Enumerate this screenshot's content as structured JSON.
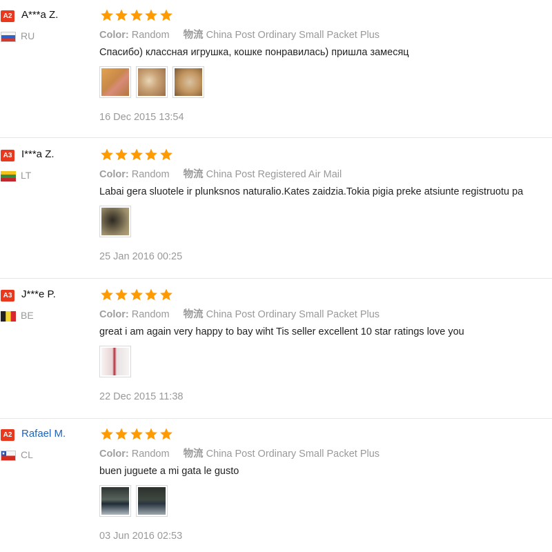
{
  "reviews": [
    {
      "level": "A2",
      "name": "A***a Z.",
      "name_is_link": false,
      "country": "RU",
      "flag": "flag-ru-icon",
      "stars": 5,
      "color_label": "Color:",
      "color_value": "Random",
      "shipping_label": "物流",
      "shipping_value": "China Post Ordinary Small Packet Plus",
      "comment": "Спасибо) классная игрушка, кошке понравилась) пришла замесяц",
      "photos": [
        "photo-thumbnail-1",
        "photo-thumbnail-2",
        "photo-thumbnail-3"
      ],
      "date": "16 Dec 2015 13:54"
    },
    {
      "level": "A3",
      "name": "I***a Z.",
      "name_is_link": false,
      "country": "LT",
      "flag": "flag-lt-icon",
      "stars": 5,
      "color_label": "Color:",
      "color_value": "Random",
      "shipping_label": "物流",
      "shipping_value": "China Post Registered Air Mail",
      "comment": "Labai gera sluotele ir plunksnos naturalio.Kates zaidzia.Tokia pigia preke atsiunte registruotu pa",
      "photos": [
        "photo-thumbnail-1"
      ],
      "date": "25 Jan 2016 00:25"
    },
    {
      "level": "A3",
      "name": "J***e P.",
      "name_is_link": false,
      "country": "BE",
      "flag": "flag-be-icon",
      "stars": 5,
      "color_label": "Color:",
      "color_value": "Random",
      "shipping_label": "物流",
      "shipping_value": "China Post Ordinary Small Packet Plus",
      "comment": "great i am again very happy to bay wiht Tis seller excellent 10 star ratings love you",
      "photos": [
        "photo-thumbnail-1"
      ],
      "date": "22 Dec 2015 11:38"
    },
    {
      "level": "A2",
      "name": "Rafael M.",
      "name_is_link": true,
      "country": "CL",
      "flag": "flag-cl-icon",
      "stars": 5,
      "color_label": "Color:",
      "color_value": "Random",
      "shipping_label": "物流",
      "shipping_value": "China Post Ordinary Small Packet Plus",
      "comment": "buen juguete a mi gata le gusto",
      "photos": [
        "photo-thumbnail-1",
        "photo-thumbnail-2"
      ],
      "date": "03 Jun 2016 02:53"
    }
  ],
  "colors": {
    "level_badge": "#e8391f",
    "star": "#ff9a00",
    "link": "#1f62b8",
    "muted_text": "#999999",
    "body_text": "#222222",
    "divider": "#e6e6e6"
  },
  "star_icon": "star-icon"
}
